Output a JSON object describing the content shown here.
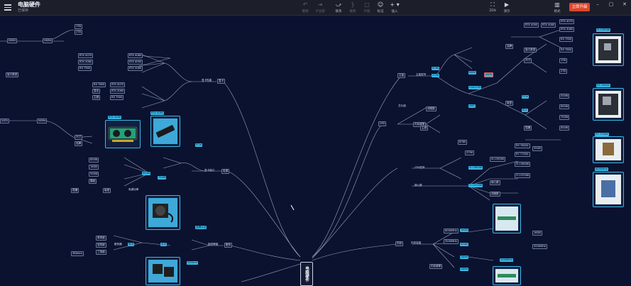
{
  "header": {
    "doc_title": "电脑硬件",
    "doc_status": "已保存",
    "upgrade_label": "立即升级"
  },
  "toolbar": {
    "undo": "撤销",
    "redo": "恢复",
    "format_painter": "格式刷",
    "insert_subtopic": "子主题",
    "insert_sibling": "主题",
    "relation": "联系",
    "summary": "概要",
    "boundary": "外框",
    "marker": "标记",
    "insert": "插入",
    "zen": "ZEN",
    "present": "演示",
    "style": "格式"
  },
  "mindmap": {
    "root": "电脑硬件",
    "left_branches": [
      {
        "label": "显卡"
      },
      {
        "label": "电源"
      },
      {
        "label": "散热"
      },
      {
        "label": "硬盘"
      }
    ],
    "right_branches": [
      {
        "label": "主板"
      },
      {
        "label": "CPU"
      },
      {
        "label": "内存"
      }
    ],
    "small_labels": [
      "显卡性能",
      "显卡接口",
      "主板型号",
      "芯片组",
      "CPU型号",
      "核心数",
      "线程数",
      "显存",
      "主频",
      "内存容量",
      "内存频率",
      "电源功率",
      "散热器",
      "固态硬盘",
      "机械硬盘",
      "风冷",
      "水冷",
      "接口类型",
      "尺寸",
      "品牌",
      "版型",
      "插槽",
      "PCIe",
      "DDR4",
      "DDR5",
      "SATA",
      "NVMe",
      "RTX 4090",
      "RTX 4080",
      "RTX 4070",
      "RTX 3060",
      "RX 7900",
      "RX 7800",
      "1TB",
      "2TB",
      "500W",
      "650W",
      "750W",
      "850W",
      "16GB",
      "32GB",
      "B760",
      "Z790",
      "B650",
      "X670",
      "LGA1700",
      "AM5",
      "i5-13600K",
      "i7-13700K",
      "i9-13900K",
      "R5 7600X",
      "R7 7700X",
      "M.2",
      "3200MHz",
      "6000MHz",
      "金牌认证",
      "模组",
      "单风扇",
      "双风扇",
      "三风扇",
      "240mm",
      "360mm"
    ]
  },
  "colors": {
    "accent": "#3bb8e6",
    "canvas_bg": "#0b1230",
    "upgrade_bg": "#e0452c"
  }
}
